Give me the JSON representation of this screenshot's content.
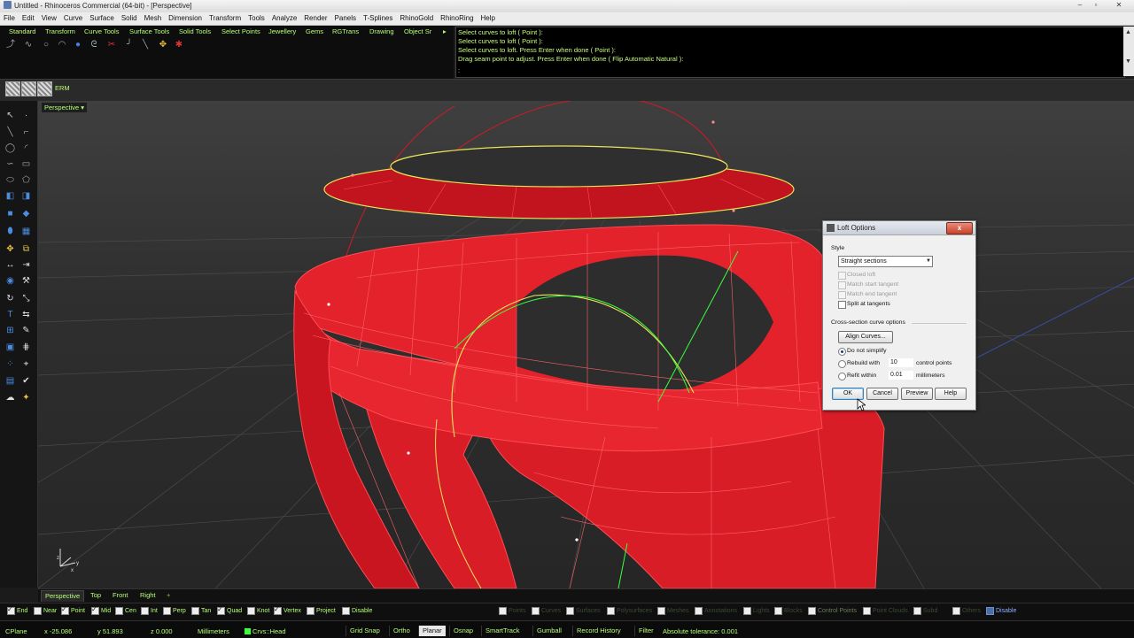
{
  "window": {
    "title": "Untitled - Rhinoceros Commercial (64-bit) - [Perspective]",
    "minimize": "–",
    "restore": "▫",
    "close": "✕"
  },
  "menu": [
    "File",
    "Edit",
    "View",
    "Curve",
    "Surface",
    "Solid",
    "Mesh",
    "Dimension",
    "Transform",
    "Tools",
    "Analyze",
    "Render",
    "Panels",
    "T-Splines",
    "RhinoGold",
    "RhinoRing",
    "Help"
  ],
  "toolbar_tabs": [
    "Standard",
    "Transform",
    "Curve Tools",
    "Surface Tools",
    "Solid Tools",
    "Select Points",
    "Jewellery",
    "Gems",
    "RGTrans",
    "Drawing",
    "Object Sr"
  ],
  "toolbar_tabs_overflow": "▸",
  "command_history": [
    "Select curves to loft ( Point ):",
    "Select curves to loft ( Point ):",
    "Select curves to loft. Press Enter when done ( Point ):",
    "Drag seam point to adjust. Press Enter when done ( Flip  Automatic  Natural ):"
  ],
  "command_prompt": ":",
  "layer_toolbar": {
    "label": "ERM"
  },
  "viewport": {
    "label": "Perspective",
    "dropdown": "▾",
    "axis": {
      "x": "x",
      "y": "y",
      "z": "z"
    }
  },
  "loft_dialog": {
    "title": "Loft Options",
    "close": "x",
    "style_label": "Style",
    "style_value": "Straight sections",
    "options": [
      {
        "label": "Closed loft",
        "checked": false,
        "disabled": true
      },
      {
        "label": "Match start tangent",
        "checked": false,
        "disabled": true
      },
      {
        "label": "Match end tangent",
        "checked": false,
        "disabled": true
      },
      {
        "label": "Split at tangents",
        "checked": false,
        "disabled": false
      }
    ],
    "cross_section_label": "Cross-section curve options",
    "align_button": "Align Curves...",
    "do_not_simplify": "Do not simplify",
    "rebuild_with": "Rebuild with",
    "rebuild_value": "10",
    "rebuild_unit": "control points",
    "refit_within": "Refit within",
    "refit_value": "0.01",
    "refit_unit": "millimeters",
    "buttons": {
      "ok": "OK",
      "cancel": "Cancel",
      "preview": "Preview",
      "help": "Help"
    }
  },
  "view_tabs": [
    "Perspective",
    "Top",
    "Front",
    "Right"
  ],
  "view_tab_add": "+",
  "osnaps": [
    {
      "label": "End",
      "checked": true
    },
    {
      "label": "Near",
      "checked": false
    },
    {
      "label": "Point",
      "checked": true
    },
    {
      "label": "Mid",
      "checked": true
    },
    {
      "label": "Cen",
      "checked": false
    },
    {
      "label": "Int",
      "checked": false
    },
    {
      "label": "Perp",
      "checked": false
    },
    {
      "label": "Tan",
      "checked": false
    },
    {
      "label": "Quad",
      "checked": true
    },
    {
      "label": "Knot",
      "checked": false
    },
    {
      "label": "Vertex",
      "checked": true
    },
    {
      "label": "Project",
      "checked": false
    },
    {
      "label": "Disable",
      "checked": false
    }
  ],
  "filters": [
    "Points",
    "Curves",
    "Surfaces",
    "Polysurfaces",
    "Meshes",
    "Annotations",
    "Lights",
    "Blocks",
    "Control Points",
    "Point Clouds",
    "Subd",
    "Others"
  ],
  "filter_disable": "Disable",
  "status": {
    "cplane": "CPlane",
    "x": "x -25.086",
    "y": "y 51.893",
    "z": "z 0.000",
    "units": "Millimeters",
    "layer": "Crvs::Head",
    "buttons": [
      "Grid Snap",
      "Ortho",
      "Planar",
      "Osnap",
      "SmartTrack",
      "Gumball",
      "Record History",
      "Filter"
    ],
    "active_button": "Planar",
    "tolerance": "Absolute tolerance: 0.001"
  },
  "colors": {
    "surface": "#e8202b",
    "accent_text": "#b7ff7a",
    "curve_yellow": "#e8e65a",
    "curve_green": "#3cff3c"
  }
}
